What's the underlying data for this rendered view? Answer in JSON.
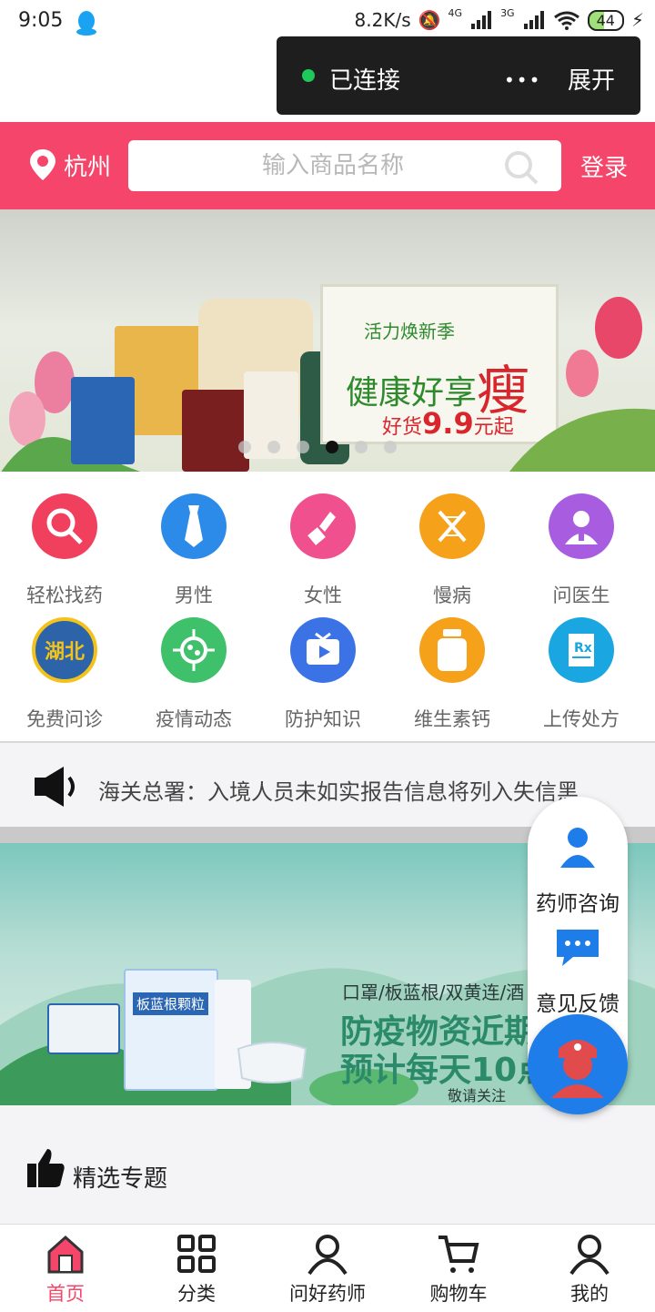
{
  "status_bar": {
    "time": "9:05",
    "speed": "8.2K/s",
    "net1": "4G",
    "net2": "3G",
    "battery": "44"
  },
  "toast": {
    "status": "已连接",
    "more": "•••",
    "expand": "展开"
  },
  "header": {
    "location": "杭州",
    "search_placeholder": "输入商品名称",
    "login": "登录"
  },
  "banner": {
    "line1": "活力焕新季",
    "line2": "健康好享",
    "line2_big": "瘦",
    "line3_prefix": "好货",
    "line3_price": "9.9",
    "line3_suffix": "元起",
    "slide_count": 6,
    "active_slide": 3
  },
  "categories": [
    {
      "label": "轻松找药",
      "icon": "magnifier-icon",
      "color": "#f0405e"
    },
    {
      "label": "男性",
      "icon": "tie-icon",
      "color": "#2c8ae8"
    },
    {
      "label": "女性",
      "icon": "lipstick-icon",
      "color": "#f0508e"
    },
    {
      "label": "慢病",
      "icon": "dna-icon",
      "color": "#f6a11a"
    },
    {
      "label": "问医生",
      "icon": "doctor-icon",
      "color": "#a85ce0"
    },
    {
      "label": "免费问诊",
      "icon": "hubei-badge-icon",
      "badge": "湖北",
      "color": "#2d63a8"
    },
    {
      "label": "疫情动态",
      "icon": "virus-icon",
      "color": "#3fc06a"
    },
    {
      "label": "防护知识",
      "icon": "tv-play-icon",
      "color": "#3b72e6"
    },
    {
      "label": "维生素钙",
      "icon": "bottle-icon",
      "color": "#f6a11a"
    },
    {
      "label": "上传处方",
      "icon": "prescription-icon",
      "color": "#1aa6e0"
    }
  ],
  "notice": {
    "text": "海关总署：入境人员未如实报告信息将列入失信黑"
  },
  "banner2": {
    "line1": "口罩/板蓝根/双黄连/酒",
    "line2": "防疫物资近期",
    "line3": "预计每天10点",
    "line4": "敬请关注",
    "product": "板蓝根颗粒"
  },
  "float_panel": {
    "pharmacist": "药师咨询",
    "feedback": "意见反馈"
  },
  "section": {
    "title": "精选专题"
  },
  "tabbar": [
    {
      "label": "首页",
      "icon": "home-icon",
      "active": true
    },
    {
      "label": "分类",
      "icon": "grid-icon",
      "active": false
    },
    {
      "label": "问好药师",
      "icon": "pharmacist-icon",
      "active": false
    },
    {
      "label": "购物车",
      "icon": "cart-icon",
      "active": false
    },
    {
      "label": "我的",
      "icon": "user-icon",
      "active": false
    }
  ],
  "colors": {
    "brand": "#f6456a",
    "fab": "#1e7de8"
  }
}
